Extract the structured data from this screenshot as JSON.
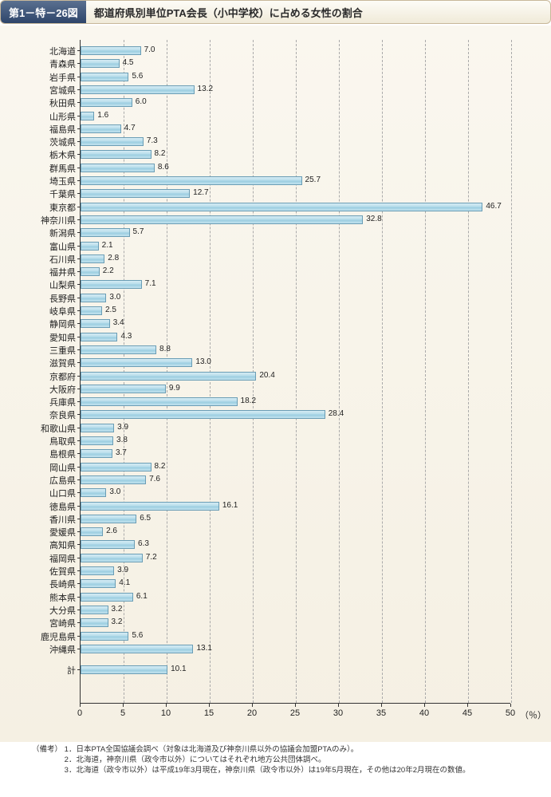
{
  "figure_number": "第1－特－26図",
  "figure_title": "都道府県別単位PTA会長（小中学校）に占める女性の割合",
  "x_unit": "（％）",
  "notes_label": "（備考）",
  "notes": [
    "1．日本PTA全国協議会調べ（対象は北海道及び神奈川県以外の協議会加盟PTAのみ）。",
    "2．北海道，神奈川県（政令市以外）についてはそれぞれ地方公共団体調べ。",
    "3．北海道（政令市以外）は平成19年3月現在，神奈川県（政令市以外）は19年5月現在，その他は20年2月現在の数値。"
  ],
  "chart_data": {
    "type": "bar",
    "orientation": "horizontal",
    "xlabel": "",
    "ylabel": "",
    "xlim": [
      0,
      50
    ],
    "xticks": [
      0,
      5,
      10,
      15,
      20,
      25,
      30,
      35,
      40,
      45,
      50
    ],
    "categories": [
      "北海道",
      "青森県",
      "岩手県",
      "宮城県",
      "秋田県",
      "山形県",
      "福島県",
      "茨城県",
      "栃木県",
      "群馬県",
      "埼玉県",
      "千葉県",
      "東京都",
      "神奈川県",
      "新潟県",
      "富山県",
      "石川県",
      "福井県",
      "山梨県",
      "長野県",
      "岐阜県",
      "静岡県",
      "愛知県",
      "三重県",
      "滋賀県",
      "京都府",
      "大阪府",
      "兵庫県",
      "奈良県",
      "和歌山県",
      "鳥取県",
      "島根県",
      "岡山県",
      "広島県",
      "山口県",
      "徳島県",
      "香川県",
      "愛媛県",
      "高知県",
      "福岡県",
      "佐賀県",
      "長崎県",
      "熊本県",
      "大分県",
      "宮崎県",
      "鹿児島県",
      "沖縄県",
      "計"
    ],
    "values": [
      7.0,
      4.5,
      5.6,
      13.2,
      6.0,
      1.6,
      4.7,
      7.3,
      8.2,
      8.6,
      25.7,
      12.7,
      46.7,
      32.8,
      5.7,
      2.1,
      2.8,
      2.2,
      7.1,
      3.0,
      2.5,
      3.4,
      4.3,
      8.8,
      13.0,
      20.4,
      9.9,
      18.2,
      28.4,
      3.9,
      3.8,
      3.7,
      8.2,
      7.6,
      3.0,
      16.1,
      6.5,
      2.6,
      6.3,
      7.2,
      3.9,
      4.1,
      6.1,
      3.2,
      3.2,
      5.6,
      13.1,
      10.1
    ],
    "separator_before": [
      "計"
    ]
  }
}
